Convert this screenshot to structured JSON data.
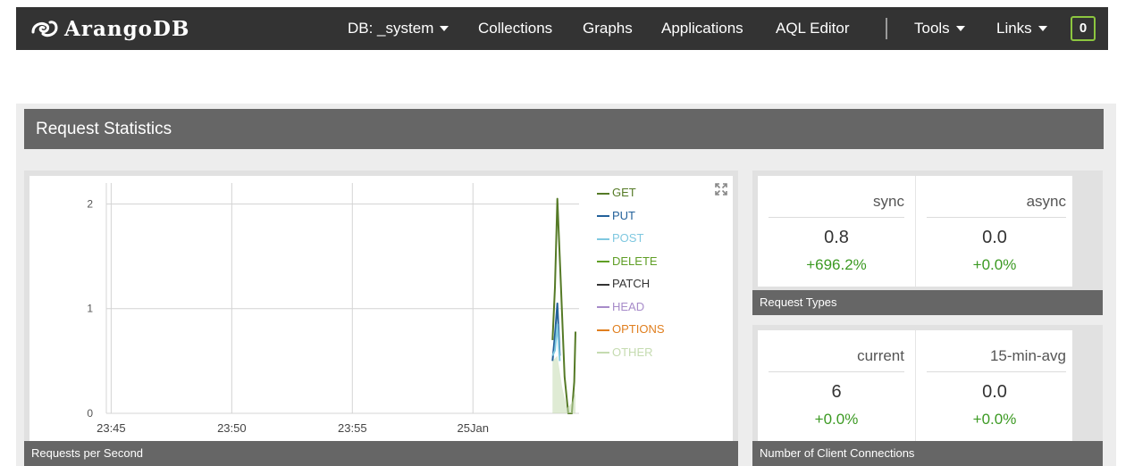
{
  "nav": {
    "brand": "ArangoDB",
    "db_selector": "DB: _system",
    "collections": "Collections",
    "graphs": "Graphs",
    "applications": "Applications",
    "aql_editor": "AQL Editor",
    "tools": "Tools",
    "links": "Links",
    "notifications": "0"
  },
  "dashboard": {
    "title": "Request Statistics",
    "chart_footer": "Requests per Second",
    "request_types": {
      "footer": "Request Types",
      "col1_label": "sync",
      "col1_value": "0.8",
      "col1_change": "+696.2%",
      "col2_label": "async",
      "col2_value": "0.0",
      "col2_change": "+0.0%"
    },
    "client_connections": {
      "footer": "Number of Client Connections",
      "col1_label": "current",
      "col1_value": "6",
      "col1_change": "+0.0%",
      "col2_label": "15-min-avg",
      "col2_value": "0.0",
      "col2_change": "+0.0%"
    }
  },
  "colors": {
    "navbar": "#333333",
    "panel_header": "#666666",
    "accent_green": "#8cc63f",
    "positive_change": "#3c9a23"
  },
  "icons": {
    "logo": "arangodb-logo-icon",
    "expand": "expand-arrows-icon",
    "dropdown": "caret-down-icon"
  },
  "chart_data": {
    "type": "line",
    "title": "",
    "xlabel": "",
    "ylabel": "",
    "x_ticks": [
      "23:45",
      "23:50",
      "23:55",
      "25Jan"
    ],
    "y_ticks": [
      0,
      1,
      2
    ],
    "ylim": [
      0,
      2.2
    ],
    "x_minutes": {
      "tick_values": [
        0,
        5,
        10,
        15
      ],
      "range": [
        -0.2,
        19.4
      ]
    },
    "legend_position": "right",
    "grid": true,
    "series": [
      {
        "name": "GET",
        "color": "#557a26",
        "x": [
          18.3,
          18.4,
          18.5,
          18.65,
          18.8,
          18.95,
          19.1,
          19.2,
          19.25
        ],
        "y": [
          0.7,
          1.2,
          2.05,
          1.2,
          0.35,
          0.0,
          0.0,
          0.3,
          0.78
        ]
      },
      {
        "name": "PUT",
        "color": "#23619a",
        "x": [
          18.3,
          18.4,
          18.5,
          18.6
        ],
        "y": [
          0.5,
          0.75,
          1.05,
          0.55
        ]
      },
      {
        "name": "POST",
        "color": "#7fc8e0",
        "x": [
          18.3,
          18.4,
          18.5,
          18.6
        ],
        "y": [
          0.55,
          0.6,
          0.85,
          0.5
        ]
      },
      {
        "name": "DELETE",
        "color": "#5f9e25",
        "x": [],
        "y": []
      },
      {
        "name": "PATCH",
        "color": "#333333",
        "x": [],
        "y": []
      },
      {
        "name": "HEAD",
        "color": "#a78bc9",
        "x": [],
        "y": []
      },
      {
        "name": "OPTIONS",
        "color": "#e07f1f",
        "x": [],
        "y": []
      },
      {
        "name": "OTHER",
        "color": "#c5dbb0",
        "x": [
          18.3,
          18.5,
          18.7,
          18.9,
          19.1,
          19.25
        ],
        "y": [
          0.5,
          0.55,
          0.25,
          0.05,
          0.1,
          0.2
        ]
      }
    ]
  }
}
